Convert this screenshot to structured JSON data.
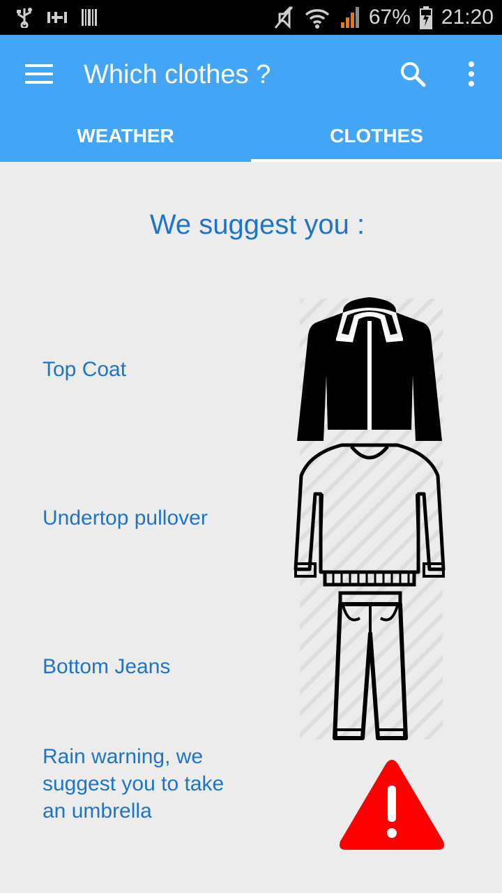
{
  "status_bar": {
    "battery": "67%",
    "time": "21:20",
    "icons": [
      "usb-icon",
      "tuner-icon",
      "barcode-icon",
      "mute-icon",
      "wifi-icon",
      "signal-icon",
      "battery-icon"
    ]
  },
  "app_bar": {
    "title": "Which clothes ?",
    "background": "#42a5f5",
    "icons": [
      "menu-icon",
      "search-icon",
      "more-vert-icon"
    ]
  },
  "tabs": [
    {
      "label": "WEATHER",
      "active": false
    },
    {
      "label": "CLOTHES",
      "active": true
    }
  ],
  "content": {
    "headline": "We suggest you :",
    "items": [
      {
        "label": "Top Coat",
        "icon": "coat-icon"
      },
      {
        "label": "Undertop pullover",
        "icon": "pullover-icon"
      },
      {
        "label": "Bottom Jeans",
        "icon": "jeans-icon"
      }
    ],
    "warning": {
      "lines": [
        "Rain warning, we",
        "suggest you to take",
        "an umbrella"
      ],
      "icon": "warning-icon",
      "color": "#ff0000"
    },
    "text_color": "#1e74c8"
  }
}
